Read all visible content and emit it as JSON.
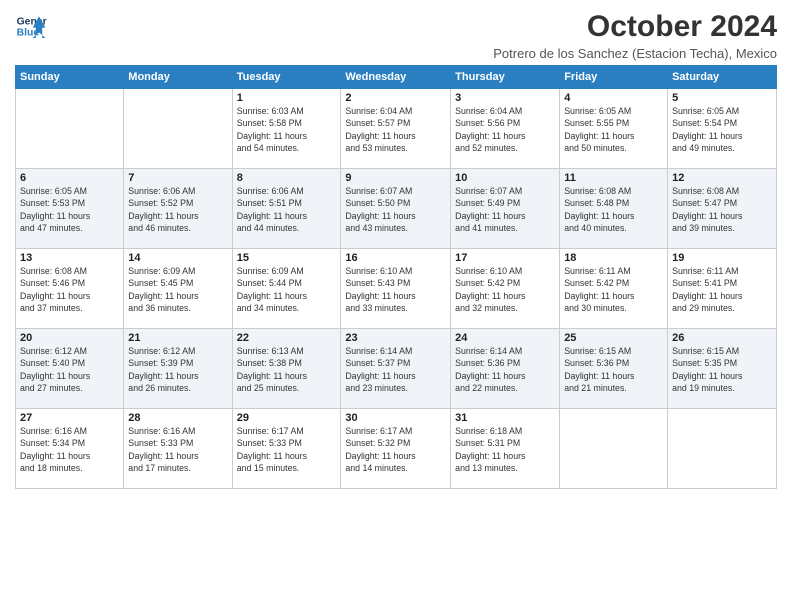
{
  "header": {
    "logo_line1": "General",
    "logo_line2": "Blue",
    "month_title": "October 2024",
    "location": "Potrero de los Sanchez (Estacion Techa), Mexico"
  },
  "weekdays": [
    "Sunday",
    "Monday",
    "Tuesday",
    "Wednesday",
    "Thursday",
    "Friday",
    "Saturday"
  ],
  "weeks": [
    [
      {
        "day": "",
        "info": ""
      },
      {
        "day": "",
        "info": ""
      },
      {
        "day": "1",
        "info": "Sunrise: 6:03 AM\nSunset: 5:58 PM\nDaylight: 11 hours\nand 54 minutes."
      },
      {
        "day": "2",
        "info": "Sunrise: 6:04 AM\nSunset: 5:57 PM\nDaylight: 11 hours\nand 53 minutes."
      },
      {
        "day": "3",
        "info": "Sunrise: 6:04 AM\nSunset: 5:56 PM\nDaylight: 11 hours\nand 52 minutes."
      },
      {
        "day": "4",
        "info": "Sunrise: 6:05 AM\nSunset: 5:55 PM\nDaylight: 11 hours\nand 50 minutes."
      },
      {
        "day": "5",
        "info": "Sunrise: 6:05 AM\nSunset: 5:54 PM\nDaylight: 11 hours\nand 49 minutes."
      }
    ],
    [
      {
        "day": "6",
        "info": "Sunrise: 6:05 AM\nSunset: 5:53 PM\nDaylight: 11 hours\nand 47 minutes."
      },
      {
        "day": "7",
        "info": "Sunrise: 6:06 AM\nSunset: 5:52 PM\nDaylight: 11 hours\nand 46 minutes."
      },
      {
        "day": "8",
        "info": "Sunrise: 6:06 AM\nSunset: 5:51 PM\nDaylight: 11 hours\nand 44 minutes."
      },
      {
        "day": "9",
        "info": "Sunrise: 6:07 AM\nSunset: 5:50 PM\nDaylight: 11 hours\nand 43 minutes."
      },
      {
        "day": "10",
        "info": "Sunrise: 6:07 AM\nSunset: 5:49 PM\nDaylight: 11 hours\nand 41 minutes."
      },
      {
        "day": "11",
        "info": "Sunrise: 6:08 AM\nSunset: 5:48 PM\nDaylight: 11 hours\nand 40 minutes."
      },
      {
        "day": "12",
        "info": "Sunrise: 6:08 AM\nSunset: 5:47 PM\nDaylight: 11 hours\nand 39 minutes."
      }
    ],
    [
      {
        "day": "13",
        "info": "Sunrise: 6:08 AM\nSunset: 5:46 PM\nDaylight: 11 hours\nand 37 minutes."
      },
      {
        "day": "14",
        "info": "Sunrise: 6:09 AM\nSunset: 5:45 PM\nDaylight: 11 hours\nand 36 minutes."
      },
      {
        "day": "15",
        "info": "Sunrise: 6:09 AM\nSunset: 5:44 PM\nDaylight: 11 hours\nand 34 minutes."
      },
      {
        "day": "16",
        "info": "Sunrise: 6:10 AM\nSunset: 5:43 PM\nDaylight: 11 hours\nand 33 minutes."
      },
      {
        "day": "17",
        "info": "Sunrise: 6:10 AM\nSunset: 5:42 PM\nDaylight: 11 hours\nand 32 minutes."
      },
      {
        "day": "18",
        "info": "Sunrise: 6:11 AM\nSunset: 5:42 PM\nDaylight: 11 hours\nand 30 minutes."
      },
      {
        "day": "19",
        "info": "Sunrise: 6:11 AM\nSunset: 5:41 PM\nDaylight: 11 hours\nand 29 minutes."
      }
    ],
    [
      {
        "day": "20",
        "info": "Sunrise: 6:12 AM\nSunset: 5:40 PM\nDaylight: 11 hours\nand 27 minutes."
      },
      {
        "day": "21",
        "info": "Sunrise: 6:12 AM\nSunset: 5:39 PM\nDaylight: 11 hours\nand 26 minutes."
      },
      {
        "day": "22",
        "info": "Sunrise: 6:13 AM\nSunset: 5:38 PM\nDaylight: 11 hours\nand 25 minutes."
      },
      {
        "day": "23",
        "info": "Sunrise: 6:14 AM\nSunset: 5:37 PM\nDaylight: 11 hours\nand 23 minutes."
      },
      {
        "day": "24",
        "info": "Sunrise: 6:14 AM\nSunset: 5:36 PM\nDaylight: 11 hours\nand 22 minutes."
      },
      {
        "day": "25",
        "info": "Sunrise: 6:15 AM\nSunset: 5:36 PM\nDaylight: 11 hours\nand 21 minutes."
      },
      {
        "day": "26",
        "info": "Sunrise: 6:15 AM\nSunset: 5:35 PM\nDaylight: 11 hours\nand 19 minutes."
      }
    ],
    [
      {
        "day": "27",
        "info": "Sunrise: 6:16 AM\nSunset: 5:34 PM\nDaylight: 11 hours\nand 18 minutes."
      },
      {
        "day": "28",
        "info": "Sunrise: 6:16 AM\nSunset: 5:33 PM\nDaylight: 11 hours\nand 17 minutes."
      },
      {
        "day": "29",
        "info": "Sunrise: 6:17 AM\nSunset: 5:33 PM\nDaylight: 11 hours\nand 15 minutes."
      },
      {
        "day": "30",
        "info": "Sunrise: 6:17 AM\nSunset: 5:32 PM\nDaylight: 11 hours\nand 14 minutes."
      },
      {
        "day": "31",
        "info": "Sunrise: 6:18 AM\nSunset: 5:31 PM\nDaylight: 11 hours\nand 13 minutes."
      },
      {
        "day": "",
        "info": ""
      },
      {
        "day": "",
        "info": ""
      }
    ]
  ]
}
